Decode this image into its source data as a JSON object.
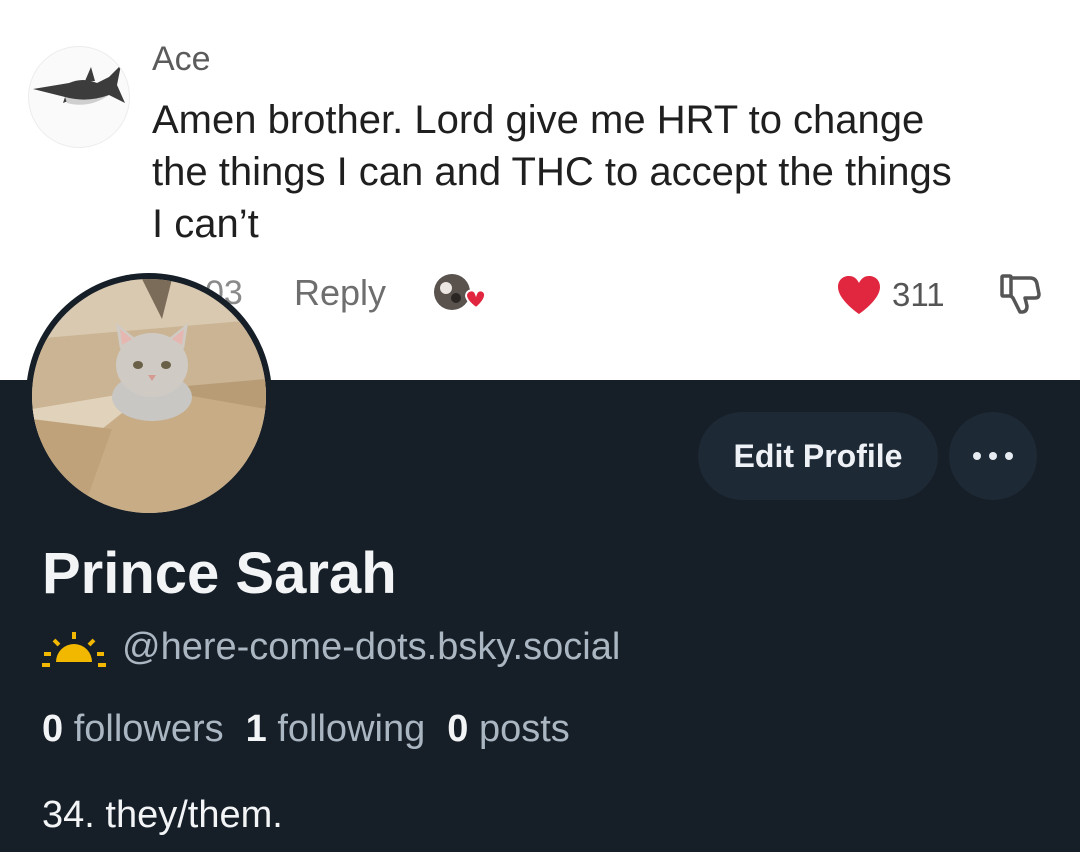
{
  "comment": {
    "author": "Ace",
    "text": "Amen brother. Lord give me HRT to change the things I can and THC to accept the things I can’t",
    "time": "03",
    "reply_label": "Reply",
    "like_count": "311",
    "icons": {
      "avatar": "shark-avatar",
      "creator": "creator-liked-icon",
      "like": "heart-icon",
      "dislike": "thumbs-down-icon"
    }
  },
  "profile": {
    "display_name": "Prince Sarah",
    "handle": "@here-come-dots.bsky.social",
    "handle_icon": "sunrise-icon",
    "stats": {
      "followers_count": "0",
      "followers_label": "followers",
      "following_count": "1",
      "following_label": "following",
      "posts_count": "0",
      "posts_label": "posts"
    },
    "bio": "34. they/them.",
    "edit_button": "Edit Profile",
    "more_icon": "ellipsis-icon"
  },
  "colors": {
    "panel_bg": "#161e27",
    "button_bg": "#1e2936",
    "handle_text": "#aab6c2",
    "heart": "#e0273f",
    "sun": "#f2b800"
  }
}
